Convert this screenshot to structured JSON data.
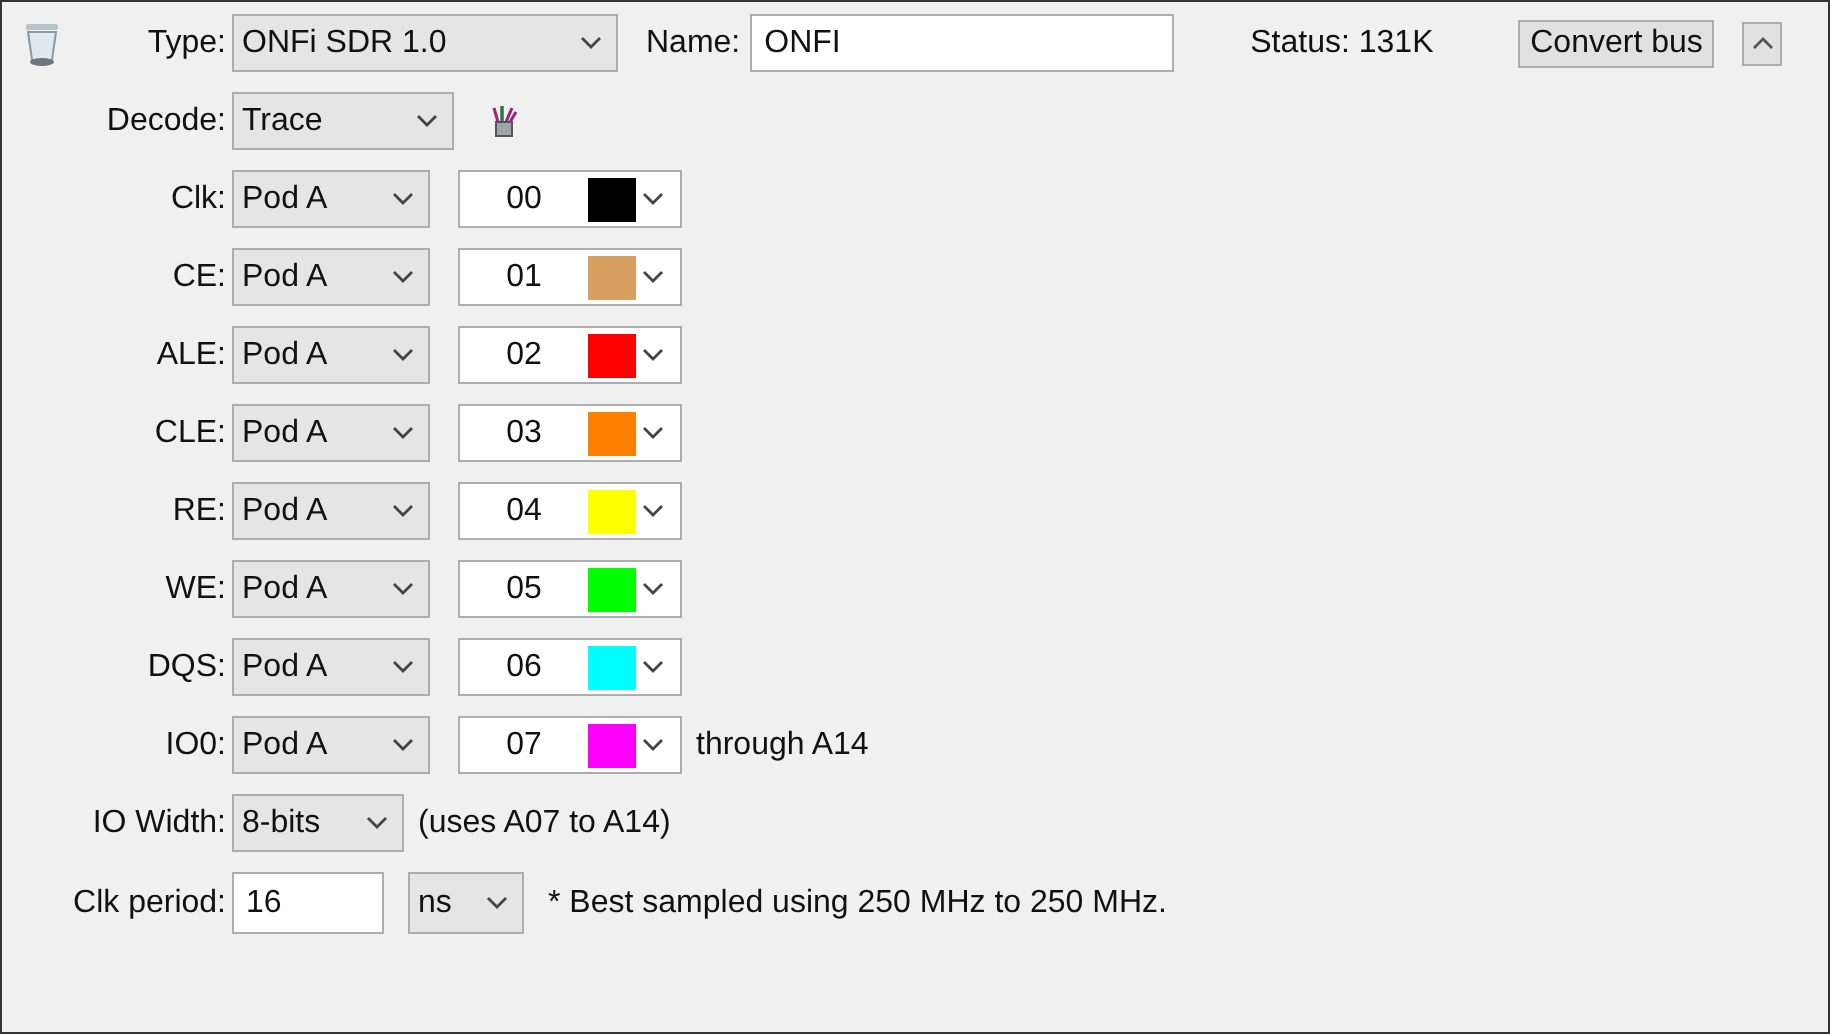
{
  "header": {
    "type_label": "Type:",
    "type_value": "ONFi SDR 1.0",
    "name_label": "Name:",
    "name_value": "ONFI",
    "status": "Status: 131K",
    "convert_button": "Convert bus"
  },
  "decode": {
    "label": "Decode:",
    "value": "Trace"
  },
  "channels": [
    {
      "label": "Clk:",
      "pod": "Pod A",
      "bit": "00",
      "color": "#000000"
    },
    {
      "label": "CE:",
      "pod": "Pod A",
      "bit": "01",
      "color": "#d8a060"
    },
    {
      "label": "ALE:",
      "pod": "Pod A",
      "bit": "02",
      "color": "#ff0000"
    },
    {
      "label": "CLE:",
      "pod": "Pod A",
      "bit": "03",
      "color": "#ff8000"
    },
    {
      "label": "RE:",
      "pod": "Pod A",
      "bit": "04",
      "color": "#ffff00"
    },
    {
      "label": "WE:",
      "pod": "Pod A",
      "bit": "05",
      "color": "#00ff00"
    },
    {
      "label": "DQS:",
      "pod": "Pod A",
      "bit": "06",
      "color": "#00ffff"
    },
    {
      "label": "IO0:",
      "pod": "Pod A",
      "bit": "07",
      "color": "#ff00ff",
      "note": "through A14"
    }
  ],
  "io_width": {
    "label": "IO Width:",
    "value": "8-bits",
    "note": "(uses A07 to A14)"
  },
  "clk_period": {
    "label": "Clk period:",
    "value": "16",
    "unit": "ns",
    "note": "* Best sampled using 250 MHz to 250 MHz."
  }
}
